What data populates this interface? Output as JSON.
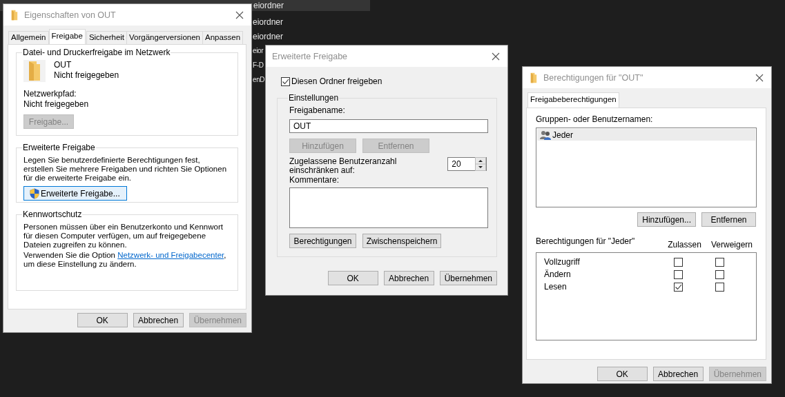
{
  "background_list": {
    "rows": [
      {
        "text": "eiordner",
        "selected": true
      },
      {
        "text": "eiordner",
        "selected": false
      },
      {
        "text": "eiordner",
        "selected": false
      },
      {
        "text": "eior",
        "selected": false
      },
      {
        "text": "F-D",
        "selected": false
      },
      {
        "text": "enD",
        "selected": false
      }
    ]
  },
  "properties_dialog": {
    "title": "Eigenschaften von OUT",
    "tabs": [
      {
        "label": "Allgemein",
        "selected": false
      },
      {
        "label": "Freigabe",
        "selected": true
      },
      {
        "label": "Sicherheit",
        "selected": false
      },
      {
        "label": "Vorgängerversionen",
        "selected": false
      },
      {
        "label": "Anpassen",
        "selected": false
      }
    ],
    "network_sharing": {
      "heading": "Datei- und Druckerfreigabe im Netzwerk",
      "name": "OUT",
      "status": "Nicht freigegeben",
      "path_label": "Netzwerkpfad:",
      "path_value": "Nicht freigegeben",
      "button": {
        "label": "Freigabe...",
        "disabled": true
      }
    },
    "advanced_sharing": {
      "heading": "Erweiterte Freigabe",
      "description": "Legen Sie benutzerdefinierte Berechtigungen fest, erstellen Sie mehrere Freigaben und richten Sie Optionen für die erweiterte Freigabe ein.",
      "button": {
        "label": "Erweiterte Freigabe...",
        "focused": true
      }
    },
    "password_protection": {
      "heading": "Kennwortschutz",
      "text": "Personen müssen über ein Benutzerkonto und Kennwort für diesen Computer verfügen, um auf freigegebene Dateien zugreifen zu können.",
      "option_before": "Verwenden Sie die Option ",
      "option_link": "Netzwerk- und Freigabecenter",
      "option_after": ", um diese Einstellung zu ändern."
    },
    "buttons": [
      {
        "label": "OK",
        "disabled": false
      },
      {
        "label": "Abbrechen",
        "disabled": false
      },
      {
        "label": "Übernehmen",
        "disabled": true
      }
    ]
  },
  "advanced_sharing_dialog": {
    "title": "Erweiterte Freigabe",
    "share_checkbox": {
      "label": "Diesen Ordner freigeben",
      "checked": true
    },
    "settings": {
      "heading": "Einstellungen",
      "share_name_label": "Freigabename:",
      "share_name_value": "OUT",
      "share_buttons": [
        {
          "label": "Hinzufügen",
          "disabled": true
        },
        {
          "label": "Entfernen",
          "disabled": true
        }
      ],
      "user_limit_label": "Zugelassene Benutzeranzahl einschränken auf:",
      "user_limit_value": "20",
      "comments_label": "Kommentare:",
      "action_buttons": [
        {
          "label": "Berechtigungen",
          "disabled": false
        },
        {
          "label": "Zwischenspeichern",
          "disabled": false
        }
      ]
    },
    "buttons": [
      {
        "label": "OK",
        "disabled": false
      },
      {
        "label": "Abbrechen",
        "disabled": false
      },
      {
        "label": "Übernehmen",
        "disabled": false
      }
    ]
  },
  "permissions_dialog": {
    "title": "Berechtigungen für \"OUT\"",
    "tabs": [
      {
        "label": "Freigabeberechtigungen",
        "selected": true
      }
    ],
    "groups_label": "Gruppen- oder Benutzernamen:",
    "groups": [
      {
        "name": "Jeder",
        "selected": true
      }
    ],
    "group_buttons": [
      {
        "label": "Hinzufügen...",
        "disabled": false
      },
      {
        "label": "Entfernen",
        "disabled": false
      }
    ],
    "permissions_label": "Berechtigungen für \"Jeder\"",
    "columns": [
      "Zulassen",
      "Verweigern"
    ],
    "permissions": [
      {
        "name": "Vollzugriff",
        "allow": false,
        "deny": false
      },
      {
        "name": "Ändern",
        "allow": false,
        "deny": false
      },
      {
        "name": "Lesen",
        "allow": true,
        "deny": false
      }
    ],
    "buttons": [
      {
        "label": "OK",
        "disabled": false
      },
      {
        "label": "Abbrechen",
        "disabled": false
      },
      {
        "label": "Übernehmen",
        "disabled": true
      }
    ]
  }
}
